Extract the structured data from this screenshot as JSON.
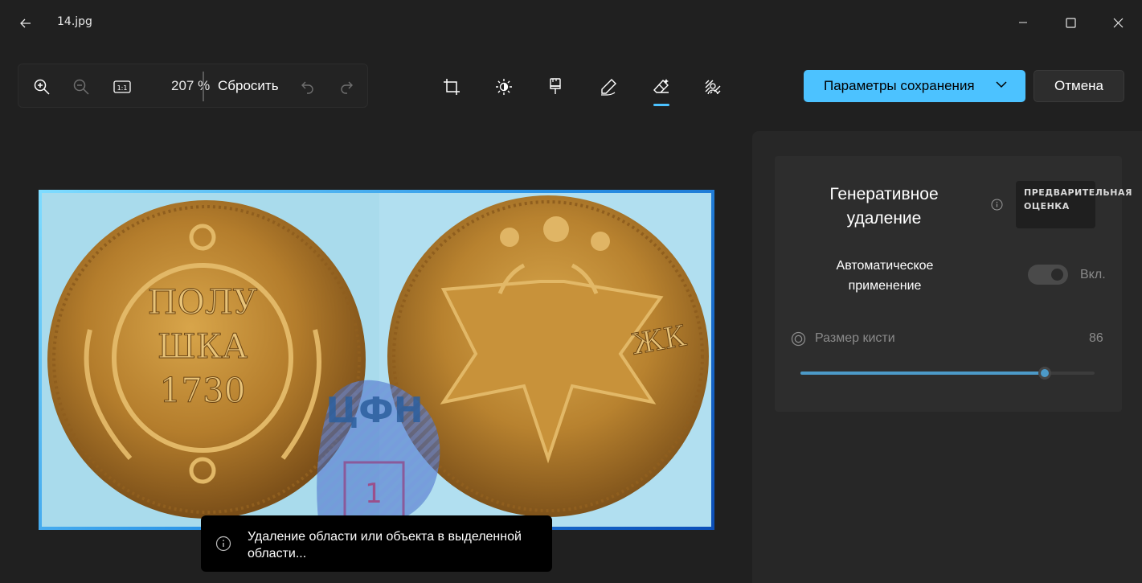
{
  "window": {
    "title": "14.jpg"
  },
  "toolbar": {
    "zoom_level": "207 %",
    "reset_label": "Сбросить"
  },
  "actions": {
    "save_label": "Параметры сохранения",
    "cancel_label": "Отмена"
  },
  "tools": [
    "crop",
    "adjust",
    "filter",
    "markup",
    "generative-erase",
    "background"
  ],
  "active_tool": "generative-erase",
  "image": {
    "watermark_text": "ЦФН",
    "watermark_number": "1",
    "coin_inscription": [
      "ПОЛУ",
      "ШКА",
      "1730"
    ]
  },
  "toast": {
    "message": "Удаление области или объекта в выделенной области..."
  },
  "panel": {
    "title": "Генеративное удаление",
    "badge": "ПРЕДВАРИТЕЛЬНАЯ ОЦЕНКА",
    "auto_apply_label": "Автоматическое применение",
    "auto_apply_state": "Вкл.",
    "brush_size_label": "Размер кисти",
    "brush_size_value": "86",
    "brush_size_fraction": 0.83
  },
  "colors": {
    "accent": "#4cc2ff",
    "background": "#202020",
    "panel": "#272727",
    "card": "#2d2d2d"
  }
}
